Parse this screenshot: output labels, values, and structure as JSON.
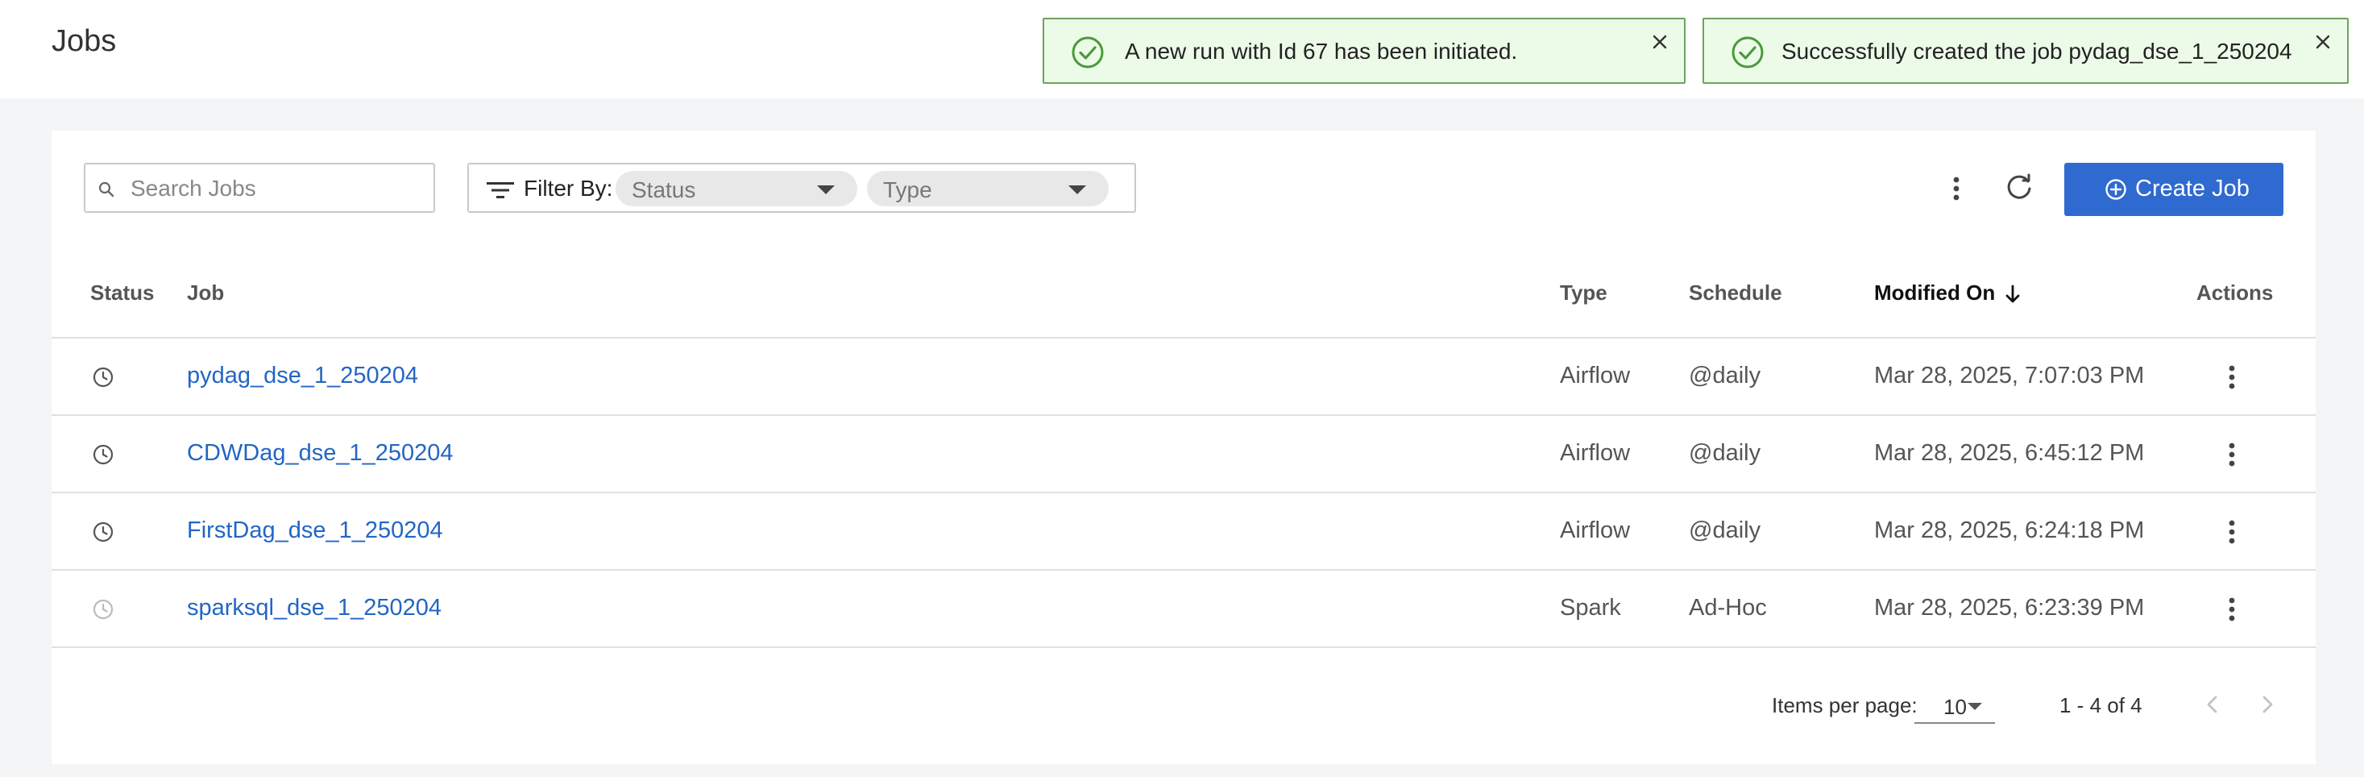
{
  "header": {
    "title": "Jobs"
  },
  "toasts": [
    {
      "message": "A new run with Id 67 has been initiated."
    },
    {
      "message": "Successfully created the job pydag_dse_1_250204"
    }
  ],
  "toolbar": {
    "search_placeholder": "Search Jobs",
    "filter_label": "Filter By:",
    "status_filter": "Status",
    "type_filter": "Type",
    "create_label": "Create Job"
  },
  "table": {
    "columns": {
      "status": "Status",
      "job": "Job",
      "type": "Type",
      "schedule": "Schedule",
      "modified_on": "Modified On",
      "actions": "Actions"
    },
    "rows": [
      {
        "job": "pydag_dse_1_250204",
        "type": "Airflow",
        "schedule": "@daily",
        "modified_on": "Mar 28, 2025, 7:07:03 PM"
      },
      {
        "job": "CDWDag_dse_1_250204",
        "type": "Airflow",
        "schedule": "@daily",
        "modified_on": "Mar 28, 2025, 6:45:12 PM"
      },
      {
        "job": "FirstDag_dse_1_250204",
        "type": "Airflow",
        "schedule": "@daily",
        "modified_on": "Mar 28, 2025, 6:24:18 PM"
      },
      {
        "job": "sparksql_dse_1_250204",
        "type": "Spark",
        "schedule": "Ad-Hoc",
        "modified_on": "Mar 28, 2025, 6:23:39 PM"
      }
    ]
  },
  "pagination": {
    "items_per_page_label": "Items per page:",
    "items_per_page": "10",
    "range": "1 - 4 of 4"
  },
  "colors": {
    "accent": "#2f6ad0",
    "link": "#2266c4",
    "toast_background": "#ecfbe8",
    "toast_border": "#6ea35e"
  }
}
